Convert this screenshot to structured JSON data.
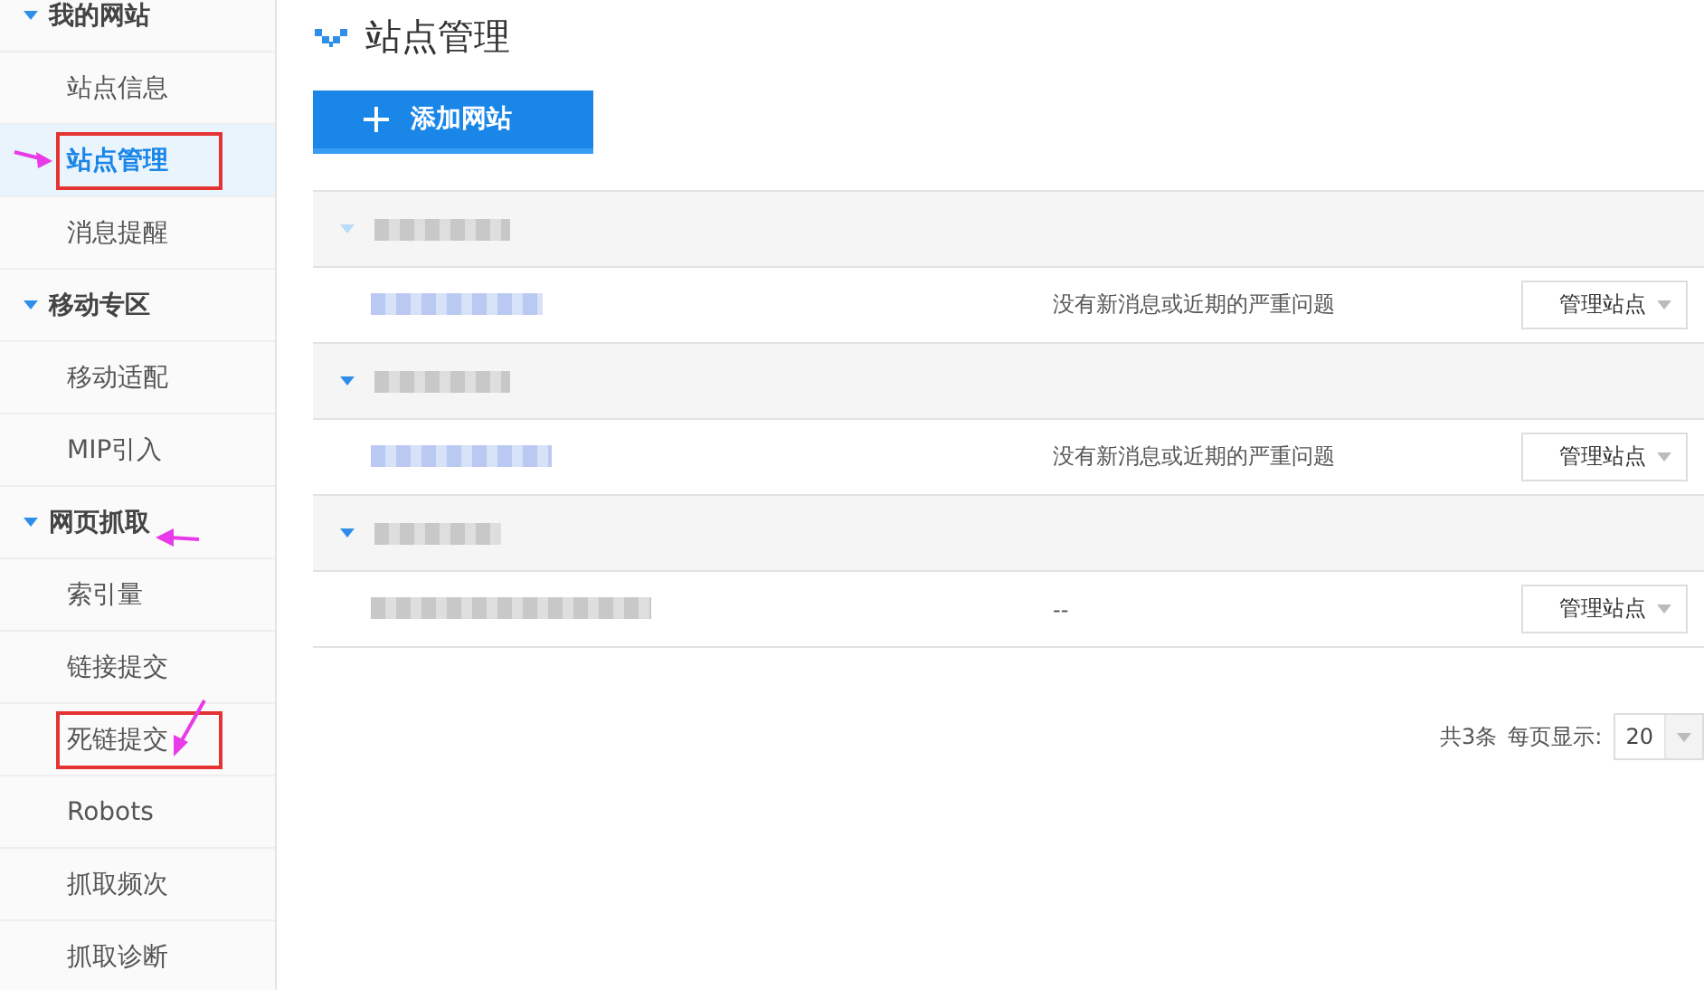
{
  "sidebar": {
    "items": [
      {
        "kind": "group",
        "label": "我的网站",
        "selected": false
      },
      {
        "kind": "item",
        "label": "站点信息",
        "selected": false,
        "boxed": false
      },
      {
        "kind": "item",
        "label": "站点管理",
        "selected": true,
        "boxed": true
      },
      {
        "kind": "item",
        "label": "消息提醒",
        "selected": false,
        "boxed": false
      },
      {
        "kind": "group",
        "label": "移动专区",
        "selected": false
      },
      {
        "kind": "item",
        "label": "移动适配",
        "selected": false,
        "boxed": false
      },
      {
        "kind": "item",
        "label": "MIP引入",
        "selected": false,
        "boxed": false
      },
      {
        "kind": "group",
        "label": "网页抓取",
        "selected": false
      },
      {
        "kind": "item",
        "label": "索引量",
        "selected": false,
        "boxed": false
      },
      {
        "kind": "item",
        "label": "链接提交",
        "selected": false,
        "boxed": false
      },
      {
        "kind": "item",
        "label": "死链提交",
        "selected": false,
        "boxed": true
      },
      {
        "kind": "item",
        "label": "Robots",
        "selected": false,
        "boxed": false
      },
      {
        "kind": "item",
        "label": "抓取频次",
        "selected": false,
        "boxed": false
      },
      {
        "kind": "item",
        "label": "抓取诊断",
        "selected": false,
        "boxed": false
      }
    ]
  },
  "page": {
    "title": "站点管理",
    "add_button": "添加网站"
  },
  "sites": [
    {
      "status": "没有新消息或近期的严重问题",
      "action": "管理站点"
    },
    {
      "status": "没有新消息或近期的严重问题",
      "action": "管理站点"
    },
    {
      "status": "--",
      "action": "管理站点"
    }
  ],
  "pagination": {
    "total": "共3条",
    "per_page_label": "每页显示:",
    "per_page": "20"
  }
}
